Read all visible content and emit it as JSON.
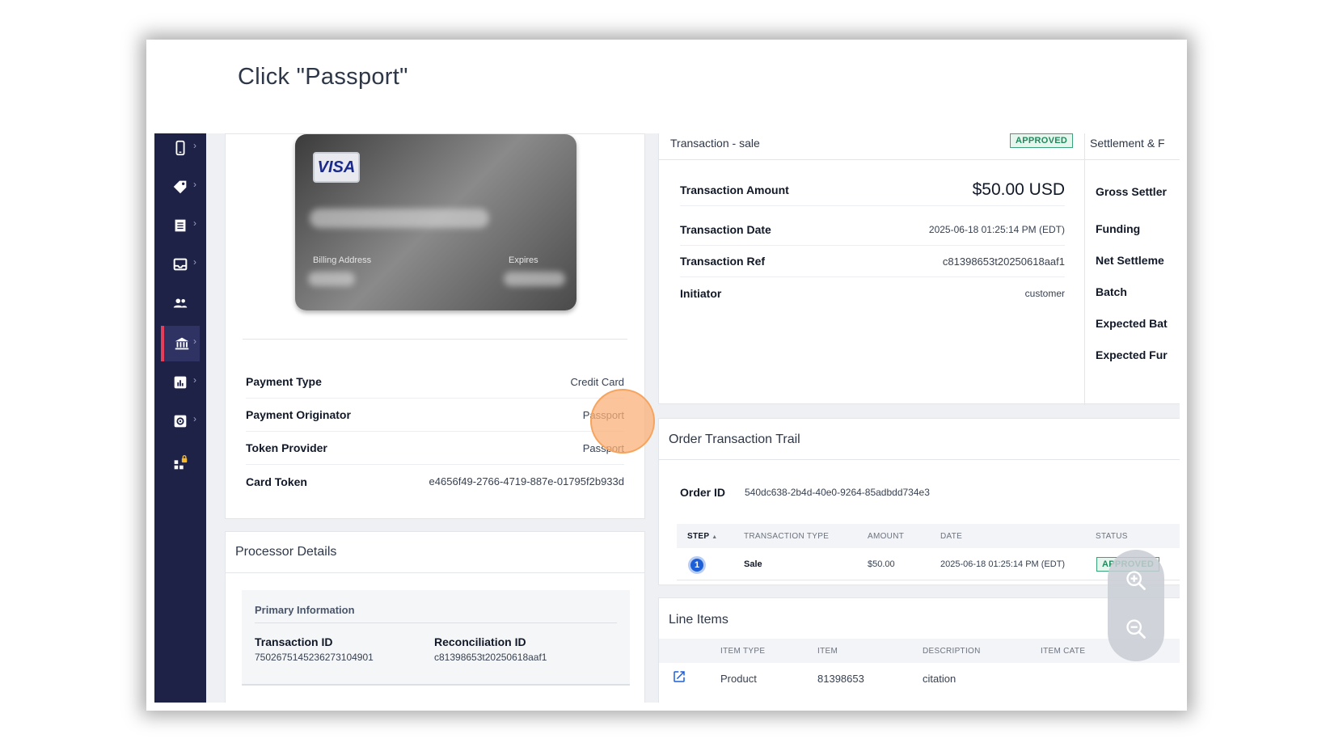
{
  "step": {
    "title": "Click \"Passport\""
  },
  "sidebar": {
    "items": [
      {
        "icon": "mobile-icon",
        "active": false
      },
      {
        "icon": "tag-icon",
        "active": false
      },
      {
        "icon": "receipt-icon",
        "active": false
      },
      {
        "icon": "inbox-icon",
        "active": false
      },
      {
        "icon": "users-icon",
        "active": false
      },
      {
        "icon": "bank-icon",
        "active": true
      },
      {
        "icon": "chart-icon",
        "active": false
      },
      {
        "icon": "settings-icon",
        "active": false
      },
      {
        "icon": "apps-lock-icon",
        "active": false
      }
    ],
    "chevron": "›"
  },
  "card": {
    "brand": "VISA",
    "billing_label": "Billing Address",
    "expires_label": "Expires"
  },
  "payment": {
    "rows": [
      {
        "label": "Payment Type",
        "value": "Credit Card"
      },
      {
        "label": "Payment Originator",
        "value": "Passport"
      },
      {
        "label": "Token Provider",
        "value": "Passport"
      },
      {
        "label": "Card Token",
        "value": "e4656f49-2766-4719-887e-01795f2b933d"
      }
    ]
  },
  "processor": {
    "title": "Processor Details",
    "primary_title": "Primary Information",
    "transaction_id_label": "Transaction ID",
    "transaction_id_value": "7502675145236273104901",
    "reconciliation_id_label": "Reconciliation ID",
    "reconciliation_id_value": "c81398653t20250618aaf1"
  },
  "transaction": {
    "header_title": "Transaction - sale",
    "status": "APPROVED",
    "settlement_title": "Settlement & F",
    "rows": [
      {
        "label": "Transaction Amount",
        "value": "$50.00 USD"
      },
      {
        "label": "Transaction Date",
        "value": "2025-06-18 01:25:14 PM (EDT)"
      },
      {
        "label": "Transaction Ref",
        "value": "c81398653t20250618aaf1"
      },
      {
        "label": "Initiator",
        "value": "customer"
      }
    ],
    "settlement_labels": [
      "Gross Settler",
      "Funding",
      "Net Settleme",
      "Batch",
      "Expected Bat",
      "Expected Fur"
    ]
  },
  "trail": {
    "title": "Order Transaction Trail",
    "order_id_label": "Order ID",
    "order_id_value": "540dc638-2b4d-40e0-9264-85adbdd734e3",
    "columns": [
      "STEP",
      "TRANSACTION TYPE",
      "AMOUNT",
      "DATE",
      "STATUS"
    ],
    "sort_indicator": "▲",
    "rows": [
      {
        "step": "1",
        "type": "Sale",
        "amount": "$50.00",
        "date": "2025-06-18 01:25:14 PM (EDT)",
        "status": "APPROVED"
      }
    ]
  },
  "line_items": {
    "title": "Line Items",
    "columns": [
      "ITEM TYPE",
      "ITEM",
      "DESCRIPTION",
      "ITEM CATE"
    ],
    "rows": [
      {
        "type": "Product",
        "item": "81398653",
        "description": "citation"
      }
    ]
  },
  "zoom": {
    "in_icon": "zoom-in-icon",
    "out_icon": "zoom-out-icon"
  }
}
